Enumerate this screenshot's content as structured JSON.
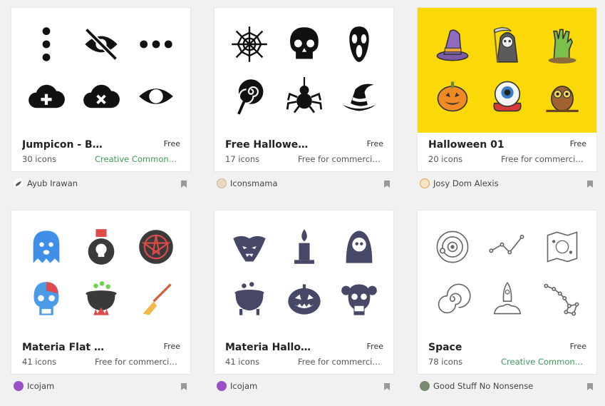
{
  "cards": [
    {
      "title": "Jumpicon - Ba...",
      "price": "Free",
      "count": "30 icons",
      "license": "Creative Commons ...",
      "author": "Ayub Irawan"
    },
    {
      "title": "Free Halloween",
      "price": "Free",
      "count": "17 icons",
      "license": "Free for commercia...",
      "author": "Iconsmama"
    },
    {
      "title": "Halloween 01",
      "price": "Free",
      "count": "20 icons",
      "license": "Free for commercia...",
      "author": "Josy Dom Alexis"
    },
    {
      "title": "Materia Flat H...",
      "price": "Free",
      "count": "41 icons",
      "license": "Free for commercia...",
      "author": "Icojam"
    },
    {
      "title": "Materia Hallo...",
      "price": "Free",
      "count": "41 icons",
      "license": "Free for commercia...",
      "author": "Icojam"
    },
    {
      "title": "Space",
      "price": "Free",
      "count": "78 icons",
      "license": "Creative Commons ...",
      "author": "Good Stuff No Nonsense"
    }
  ],
  "colors": {
    "background": "#f1f1f1",
    "license_cc": "#3d9a56",
    "yellow_preview": "#fbd808"
  }
}
